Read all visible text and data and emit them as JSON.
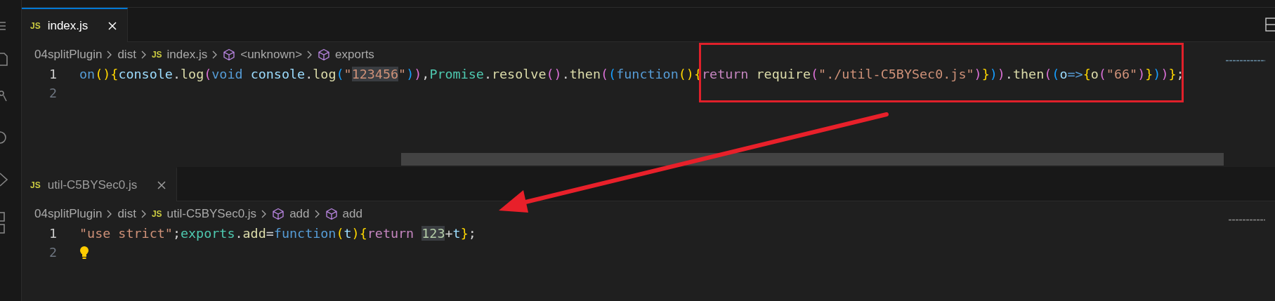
{
  "panes": [
    {
      "tab": {
        "badge": "JS",
        "label": "index.js",
        "selected": true
      },
      "breadcrumbs": [
        {
          "label": "04splitPlugin",
          "kind": "text"
        },
        {
          "label": "dist",
          "kind": "text"
        },
        {
          "badge": "JS",
          "label": "index.js",
          "kind": "file"
        },
        {
          "label": "<unknown>",
          "kind": "symbol"
        },
        {
          "label": "exports",
          "kind": "symbol"
        }
      ],
      "lines": [
        {
          "number": "1",
          "current": true,
          "lightbulb": false,
          "tokens": [
            {
              "text": "on",
              "kind": "keyword"
            },
            {
              "text": "()",
              "kind": "bracket1"
            },
            {
              "text": "{",
              "kind": "bracket1"
            },
            {
              "text": "console",
              "kind": "variable"
            },
            {
              "text": ".",
              "kind": "punctuation"
            },
            {
              "text": "log",
              "kind": "function"
            },
            {
              "text": "(",
              "kind": "bracket2"
            },
            {
              "text": "void ",
              "kind": "keyword"
            },
            {
              "text": "console",
              "kind": "variable"
            },
            {
              "text": ".",
              "kind": "punctuation"
            },
            {
              "text": "log",
              "kind": "function"
            },
            {
              "text": "(",
              "kind": "bracket3"
            },
            {
              "text": "\"",
              "kind": "string"
            },
            {
              "text": "123456",
              "kind": "string",
              "highlighted": true
            },
            {
              "text": "\"",
              "kind": "string"
            },
            {
              "text": ")",
              "kind": "bracket3"
            },
            {
              "text": ")",
              "kind": "bracket2"
            },
            {
              "text": ",",
              "kind": "punctuation"
            },
            {
              "text": "Promise",
              "kind": "class"
            },
            {
              "text": ".",
              "kind": "punctuation"
            },
            {
              "text": "resolve",
              "kind": "function"
            },
            {
              "text": "()",
              "kind": "bracket2"
            },
            {
              "text": ".",
              "kind": "punctuation"
            },
            {
              "text": "then",
              "kind": "function"
            },
            {
              "text": "(",
              "kind": "bracket2"
            },
            {
              "text": "(",
              "kind": "bracket3"
            },
            {
              "text": "function",
              "kind": "keyword"
            },
            {
              "text": "()",
              "kind": "bracket1"
            },
            {
              "text": "{",
              "kind": "bracket1"
            },
            {
              "text": "return ",
              "kind": "control"
            },
            {
              "text": "require",
              "kind": "function"
            },
            {
              "text": "(",
              "kind": "bracket2"
            },
            {
              "text": "\"./util-C5BYSec0.js\"",
              "kind": "string"
            },
            {
              "text": ")",
              "kind": "bracket2"
            },
            {
              "text": "}",
              "kind": "bracket1"
            },
            {
              "text": ")",
              "kind": "bracket3"
            },
            {
              "text": ")",
              "kind": "bracket2"
            },
            {
              "text": ".",
              "kind": "punctuation"
            },
            {
              "text": "then",
              "kind": "function"
            },
            {
              "text": "(",
              "kind": "bracket2"
            },
            {
              "text": "(",
              "kind": "bracket3"
            },
            {
              "text": "o",
              "kind": "variable"
            },
            {
              "text": "=>",
              "kind": "keyword"
            },
            {
              "text": "{",
              "kind": "bracket1"
            },
            {
              "text": "o",
              "kind": "function"
            },
            {
              "text": "(",
              "kind": "bracket2"
            },
            {
              "text": "\"66\"",
              "kind": "string"
            },
            {
              "text": ")",
              "kind": "bracket2"
            },
            {
              "text": "}",
              "kind": "bracket1"
            },
            {
              "text": ")",
              "kind": "bracket3"
            },
            {
              "text": ")",
              "kind": "bracket2"
            },
            {
              "text": "}",
              "kind": "bracket1"
            },
            {
              "text": ";",
              "kind": "punctuation"
            }
          ]
        },
        {
          "number": "2",
          "current": false,
          "lightbulb": false
        }
      ]
    },
    {
      "tab": {
        "badge": "JS",
        "label": "util-C5BYSec0.js",
        "selected": false
      },
      "breadcrumbs": [
        {
          "label": "04splitPlugin",
          "kind": "text"
        },
        {
          "label": "dist",
          "kind": "text"
        },
        {
          "badge": "JS",
          "label": "util-C5BYSec0.js",
          "kind": "file"
        },
        {
          "label": "add",
          "kind": "symbol"
        },
        {
          "label": "add",
          "kind": "symbol"
        }
      ],
      "lines": [
        {
          "number": "1",
          "current": true,
          "lightbulb": false,
          "tokens": [
            {
              "text": "\"use strict\"",
              "kind": "string"
            },
            {
              "text": ";",
              "kind": "punctuation"
            },
            {
              "text": "exports",
              "kind": "class"
            },
            {
              "text": ".",
              "kind": "punctuation"
            },
            {
              "text": "add",
              "kind": "function"
            },
            {
              "text": "=",
              "kind": "punctuation"
            },
            {
              "text": "function",
              "kind": "keyword"
            },
            {
              "text": "(",
              "kind": "bracket1"
            },
            {
              "text": "t",
              "kind": "variable"
            },
            {
              "text": ")",
              "kind": "bracket1"
            },
            {
              "text": "{",
              "kind": "bracket1"
            },
            {
              "text": "return ",
              "kind": "control"
            },
            {
              "text": "123",
              "kind": "number",
              "highlighted": true
            },
            {
              "text": "+",
              "kind": "punctuation"
            },
            {
              "text": "t",
              "kind": "variable"
            },
            {
              "text": "}",
              "kind": "bracket1"
            },
            {
              "text": ";",
              "kind": "punctuation"
            }
          ]
        },
        {
          "number": "2",
          "current": false,
          "lightbulb": true
        }
      ]
    }
  ],
  "annotation": {
    "box": true,
    "arrow": true
  }
}
